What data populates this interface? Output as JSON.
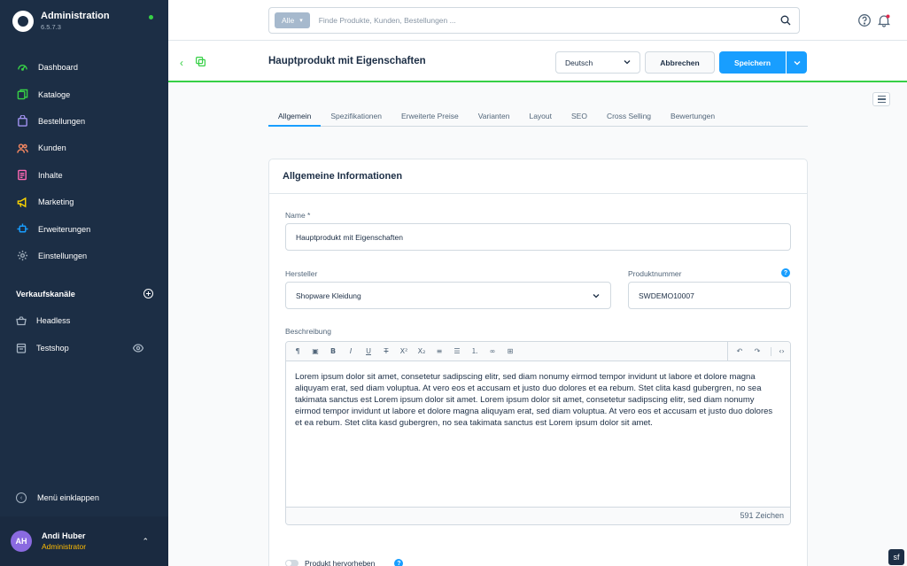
{
  "app": {
    "title": "Administration",
    "version": "6.5.7.3",
    "status_color": "#37d046"
  },
  "nav": [
    {
      "label": "Dashboard",
      "icon": "dashboard-icon",
      "color": "#37d046"
    },
    {
      "label": "Kataloge",
      "icon": "catalog-icon",
      "color": "#37d046"
    },
    {
      "label": "Bestellungen",
      "icon": "orders-icon",
      "color": "#a092f0"
    },
    {
      "label": "Kunden",
      "icon": "customers-icon",
      "color": "#f88962"
    },
    {
      "label": "Inhalte",
      "icon": "content-icon",
      "color": "#ff68b4"
    },
    {
      "label": "Marketing",
      "icon": "marketing-icon",
      "color": "#ffd700"
    },
    {
      "label": "Erweiterungen",
      "icon": "extensions-icon",
      "color": "#189eff"
    },
    {
      "label": "Einstellungen",
      "icon": "settings-icon",
      "color": "#9aa8b5"
    }
  ],
  "sales_channels": {
    "title": "Verkaufskanäle",
    "items": [
      {
        "label": "Headless",
        "icon": "basket-icon"
      },
      {
        "label": "Testshop",
        "icon": "storefront-icon"
      }
    ]
  },
  "sidebar_collapse": "Menü einklappen",
  "user": {
    "initials": "AH",
    "name": "Andi Huber",
    "role": "Administrator"
  },
  "search": {
    "type": "Alle",
    "placeholder": "Finde Produkte, Kunden, Bestellungen ..."
  },
  "header": {
    "title": "Hauptprodukt mit Eigenschaften",
    "language": "Deutsch",
    "cancel_label": "Abbrechen",
    "save_label": "Speichern"
  },
  "tabs": [
    "Allgemein",
    "Spezifikationen",
    "Erweiterte Preise",
    "Varianten",
    "Layout",
    "SEO",
    "Cross Selling",
    "Bewertungen"
  ],
  "card": {
    "title": "Allgemeine Informationen",
    "name_label": "Name *",
    "name_value": "Hauptprodukt mit Eigenschaften",
    "manufacturer_label": "Hersteller",
    "manufacturer_value": "Shopware Kleidung",
    "product_number_label": "Produktnummer",
    "product_number_value": "SWDEMO10007",
    "description_label": "Beschreibung",
    "description_text": "Lorem ipsum dolor sit amet, consetetur sadipscing elitr, sed diam nonumy eirmod tempor invidunt ut labore et dolore magna aliquyam erat, sed diam voluptua. At vero eos et accusam et justo duo dolores et ea rebum. Stet clita kasd gubergren, no sea takimata sanctus est Lorem ipsum dolor sit amet. Lorem ipsum dolor sit amet, consetetur sadipscing elitr, sed diam nonumy eirmod tempor invidunt ut labore et dolore magna aliquyam erat, sed diam voluptua. At vero eos et accusam et justo duo dolores et ea rebum. Stet clita kasd gubergren, no sea takimata sanctus est Lorem ipsum dolor sit amet.",
    "char_count": "591 Zeichen",
    "highlight_label": "Produkt hervorheben"
  },
  "colors": {
    "accent": "#189eff",
    "sidebar_bg": "#1c2e45",
    "success": "#37d046"
  }
}
